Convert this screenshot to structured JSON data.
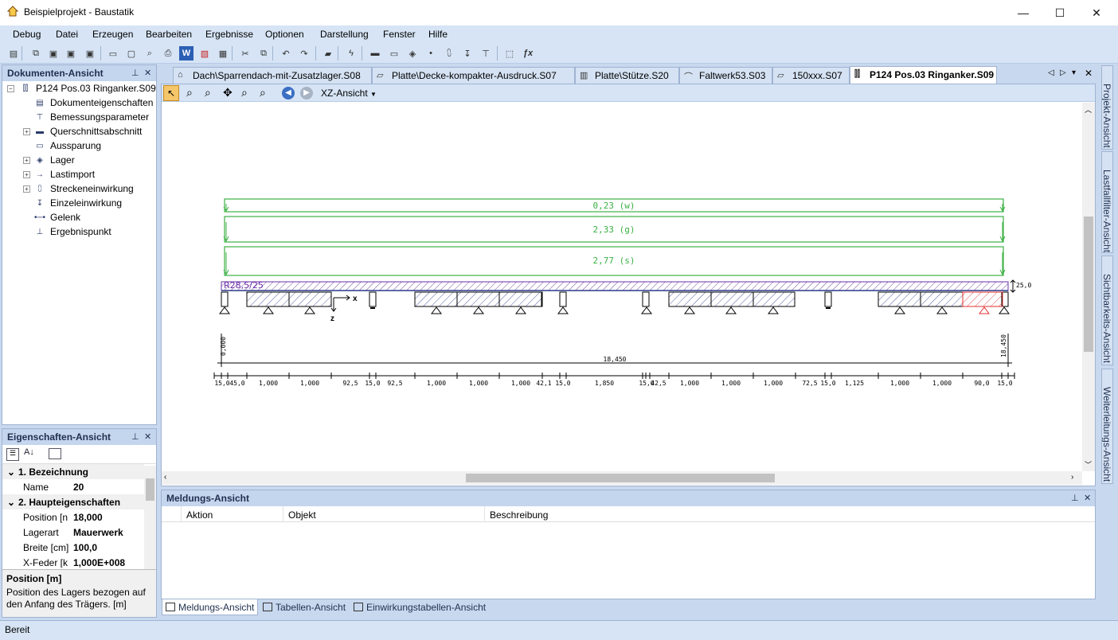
{
  "window": {
    "title": "Beispielprojekt - Baustatik",
    "minimize": "—",
    "maximize": "☐",
    "close": "✕"
  },
  "menu": [
    "Debug",
    "Datei",
    "Erzeugen",
    "Bearbeiten",
    "Ergebnisse",
    "Optionen",
    "Darstellung",
    "Fenster",
    "Hilfe"
  ],
  "toolbar_icons": [
    "new-icon",
    "copy-doc-icon",
    "save-icon",
    "save-as-icon",
    "save-all-icon",
    "page-icon",
    "preview-icon",
    "print-preview-icon",
    "print-icon",
    "word-icon",
    "pdf-icon",
    "export-icon",
    "cut-icon",
    "copy-icon",
    "undo-icon",
    "redo-icon",
    "open-folder-icon",
    "calculate-icon",
    "section-icon",
    "recess-icon",
    "support-icon",
    "hinge-icon",
    "line-load-icon",
    "point-load-icon",
    "result-point-icon",
    "select-all-icon",
    "formula-icon"
  ],
  "dokumenten_ansicht": {
    "title": "Dokumenten-Ansicht",
    "pin": "📌",
    "close": "✕",
    "root": "P124 Pos.03 Ringanker.S09",
    "items": [
      {
        "label": "Dokumenteigenschaften",
        "expandable": false
      },
      {
        "label": "Bemessungsparameter",
        "expandable": false
      },
      {
        "label": "Querschnittsabschnitt",
        "expandable": true
      },
      {
        "label": "Aussparung",
        "expandable": false
      },
      {
        "label": "Lager",
        "expandable": true
      },
      {
        "label": "Lastimport",
        "expandable": true
      },
      {
        "label": "Streckeneinwirkung",
        "expandable": true
      },
      {
        "label": "Einzeleinwirkung",
        "expandable": false
      },
      {
        "label": "Gelenk",
        "expandable": false
      },
      {
        "label": "Ergebnispunkt",
        "expandable": false
      }
    ]
  },
  "eigenschaften_ansicht": {
    "title": "Eigenschaften-Ansicht",
    "rows": [
      {
        "type": "cat",
        "label": "1. Bezeichnung"
      },
      {
        "type": "prop",
        "label": "Name",
        "value": "20"
      },
      {
        "type": "cat",
        "label": "2. Haupteigenschaften"
      },
      {
        "type": "prop",
        "label": "Position [n",
        "value": "18,000"
      },
      {
        "type": "prop",
        "label": "Lagerart",
        "value": "Mauerwerk"
      },
      {
        "type": "prop",
        "label": "Breite [cm]",
        "value": "100,0"
      },
      {
        "type": "prop",
        "label": "X-Feder [k",
        "value": "1,000E+008"
      }
    ],
    "desc_title": "Position [m]",
    "desc_text": "Position des Lagers bezogen auf den Anfang des Trägers. [m]"
  },
  "doc_tabs": [
    {
      "label": "Dach\\Sparrendach-mit-Zusatzlager.S08",
      "active": false
    },
    {
      "label": "Platte\\Decke-kompakter-Ausdruck.S07",
      "active": false
    },
    {
      "label": "Platte\\Stütze.S20",
      "active": false
    },
    {
      "label": "Faltwerk53.S03",
      "active": false
    },
    {
      "label": "150xxx.S07",
      "active": false
    },
    {
      "label": "P124 Pos.03 Ringanker.S09",
      "active": true
    }
  ],
  "view_toolbar": {
    "view_name": "XZ-Ansicht"
  },
  "drawing": {
    "loads": [
      "0,23 (w)",
      "2,33 (g)",
      "2,77 (s)"
    ],
    "section_label": "R28,5/25",
    "height_label": "25,0",
    "axis_x": "x",
    "axis_z": "z",
    "left_coord": "0,000",
    "right_coord": "18,450",
    "total_length": "18,450",
    "dims": [
      "15,0",
      "45,0",
      "1,000",
      "1,000",
      "92,5",
      "15,0",
      "92,5",
      "1,000",
      "1,000",
      "1,000",
      "42,1",
      "15,0",
      "1,850",
      "15,0",
      "42,5",
      "1,000",
      "1,000",
      "1,000",
      "72,5",
      "15,0",
      "1,125",
      "1,000",
      "1,000",
      "90,0",
      "15,0"
    ]
  },
  "meldungs_ansicht": {
    "title": "Meldungs-Ansicht",
    "columns": [
      "Aktion",
      "Objekt",
      "Beschreibung"
    ]
  },
  "bottom_tabs": [
    "Meldungs-Ansicht",
    "Tabellen-Ansicht",
    "Einwirkungstabellen-Ansicht"
  ],
  "side_tabs": [
    "Projekt-Ansicht",
    "Lastfallfilter-Ansicht",
    "Sichtbarkeits-Ansicht",
    "Weiterleitungs-Ansicht"
  ],
  "status": "Bereit",
  "colors": {
    "load_green": "#3cb043",
    "section_purple": "#6a2fa8",
    "highlight_red": "#e03030",
    "support_blue": "#2a3a8a"
  }
}
